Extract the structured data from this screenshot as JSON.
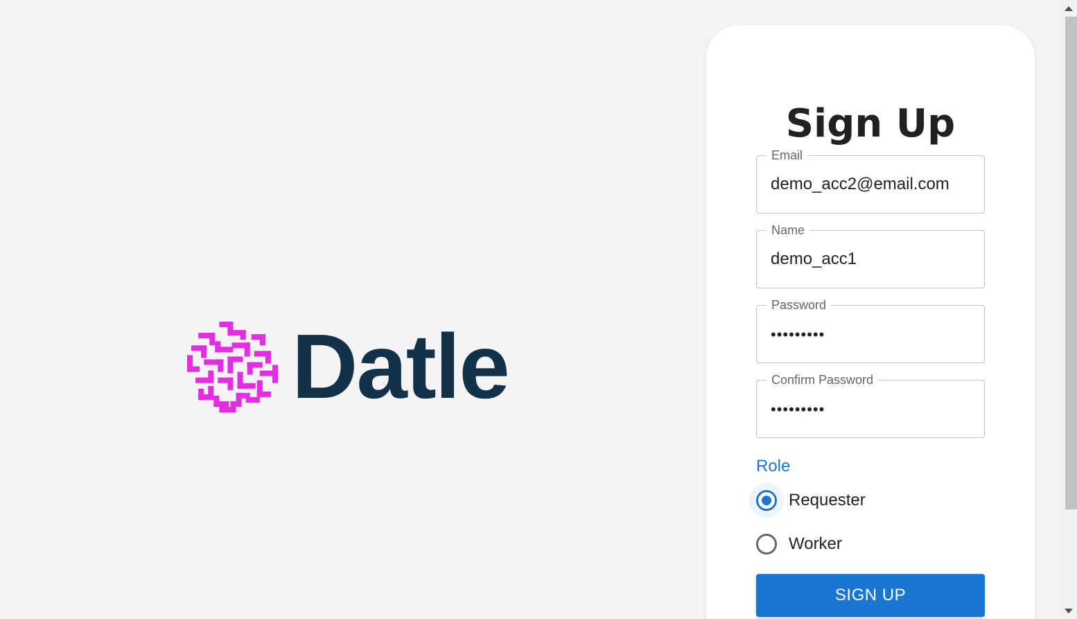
{
  "brand": {
    "name": "Datle",
    "logo_icon": "maze-grid-icon",
    "logo_color": "#e02ee0",
    "name_color": "#123249"
  },
  "form": {
    "title": "Sign Up",
    "email": {
      "label": "Email",
      "value": "demo_acc2@email.com"
    },
    "name": {
      "label": "Name",
      "value": "demo_acc1"
    },
    "password": {
      "label": "Password",
      "value": "•••••••••"
    },
    "confirm_password": {
      "label": "Confirm Password",
      "value": "•••••••••"
    },
    "role": {
      "label": "Role",
      "options": [
        {
          "label": "Requester",
          "selected": true
        },
        {
          "label": "Worker",
          "selected": false
        }
      ]
    },
    "submit_label": "SIGN UP"
  },
  "colors": {
    "accent": "#1976d2",
    "background": "#f4f4f4",
    "card": "#ffffff"
  }
}
